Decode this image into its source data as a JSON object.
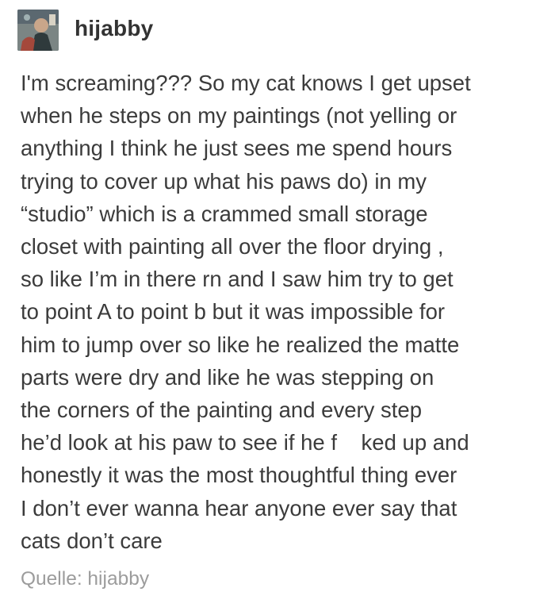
{
  "post": {
    "author": {
      "username": "hijabby",
      "avatar_icon": "user-avatar-image"
    },
    "body_lines": [
      "I'm screaming??? So my cat knows I get upset",
      "when he steps on my paintings (not yelling or",
      "anything I think he just sees me spend hours",
      "trying to cover up what his paws do) in my",
      "“studio” which is a crammed small storage",
      "closet with painting all over the floor drying ,",
      "so like I’m in there rn and I saw him try to get",
      "to point A to point b but it was impossible for",
      "him to jump over so like he realized the matte",
      "parts were dry and like he was stepping on",
      "the corners of the painting and every step",
      "he’d look at his paw to see if he f    ked up and",
      "honestly it was the most thoughtful thing ever",
      "I don’t ever wanna hear anyone ever say that",
      "cats don’t care"
    ],
    "source_label": "Quelle: hijabby"
  }
}
